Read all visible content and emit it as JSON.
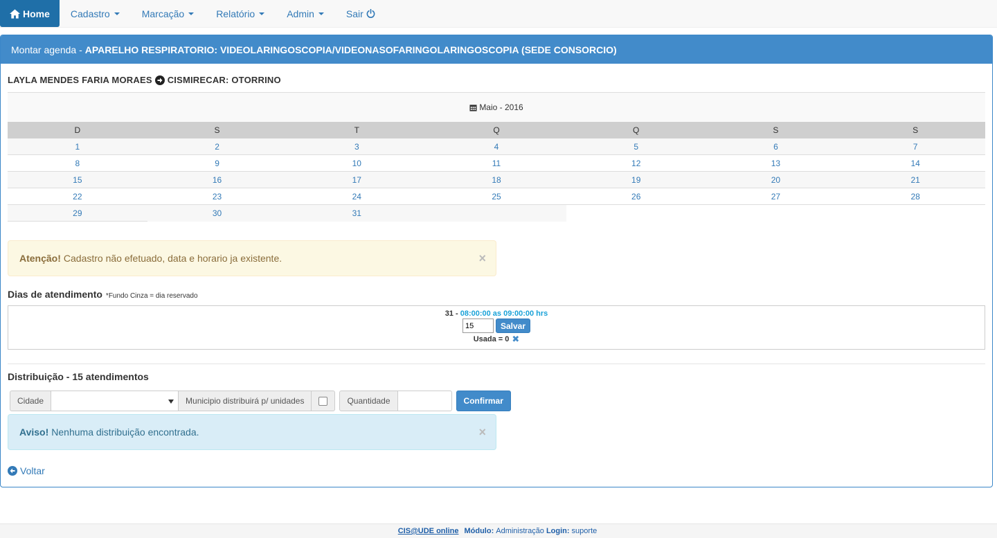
{
  "nav": {
    "home": "Home",
    "items": [
      "Cadastro",
      "Marcação",
      "Relatório",
      "Admin"
    ],
    "exit": "Sair"
  },
  "panel": {
    "title_prefix": "Montar agenda -",
    "title_main": "APARELHO RESPIRATORIO: VIDEOLARINGOSCOPIA/VIDEONASOFARINGOLARINGOSCOPIA (SEDE CONSORCIO)"
  },
  "doctor": {
    "name": "LAYLA MENDES FARIA MORAES",
    "place": "CISMIRECAR: OTORRINO"
  },
  "calendar": {
    "month": "Maio - 2016",
    "weekdays": [
      "D",
      "S",
      "T",
      "Q",
      "Q",
      "S",
      "S"
    ],
    "weeks": [
      [
        "1",
        "2",
        "3",
        "4",
        "5",
        "6",
        "7"
      ],
      [
        "8",
        "9",
        "10",
        "11",
        "12",
        "13",
        "14"
      ],
      [
        "15",
        "16",
        "17",
        "18",
        "19",
        "20",
        "21"
      ],
      [
        "22",
        "23",
        "24",
        "25",
        "26",
        "27",
        "28"
      ],
      [
        "29",
        "30",
        "31"
      ]
    ]
  },
  "alert_warning": {
    "strong": "Atenção!",
    "text": "Cadastro não efetuado, data e horario ja existente."
  },
  "dias": {
    "title": "Dias de atendimento",
    "note": "*Fundo Cinza = dia reservado",
    "day": "31 -",
    "time": "08:00:00 as 09:00:00 hrs",
    "input_value": "15",
    "save_label": "Salvar",
    "used": "Usada = 0"
  },
  "distribution": {
    "title": "Distribuição - 15 atendimentos",
    "city_label": "Cidade",
    "municipio_label": "Municipio distribuirá p/ unidades",
    "quantity_label": "Quantidade",
    "confirm_label": "Confirmar"
  },
  "alert_info": {
    "strong": "Aviso!",
    "text": "Nenhuma distribuição encontrada."
  },
  "back_label": "Voltar",
  "footer": {
    "brand": "CIS@UDE online",
    "module_label": "Módulo:",
    "module_value": "Administração",
    "login_label": "Login:",
    "login_value": "suporte"
  }
}
